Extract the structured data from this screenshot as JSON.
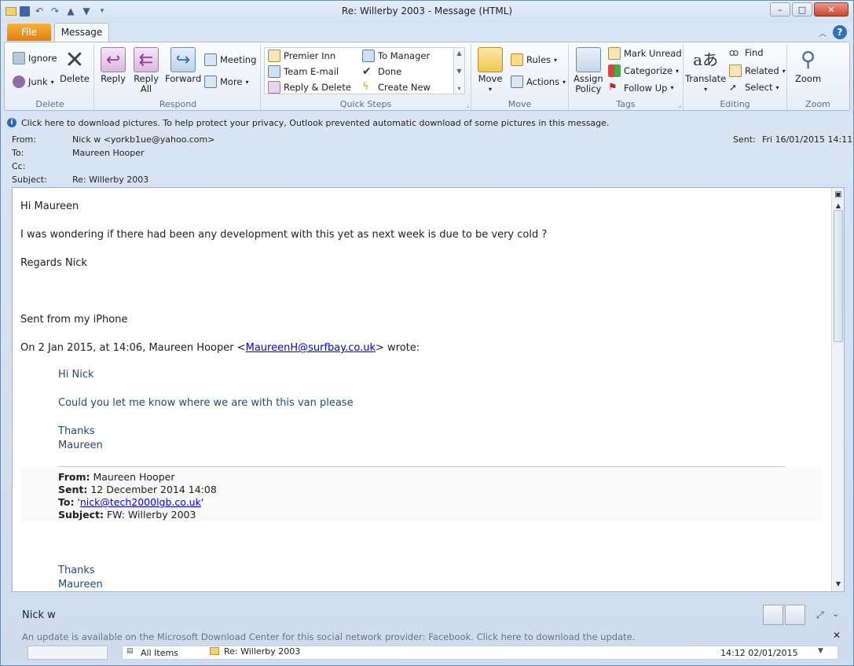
{
  "window": {
    "title": "Re: Willerby 2003  -  Message (HTML)"
  },
  "tabs": {
    "file": "File",
    "message": "Message"
  },
  "ribbon": {
    "delete_group": {
      "label": "Delete",
      "ignore": "Ignore",
      "junk": "Junk",
      "delete": "Delete"
    },
    "respond_group": {
      "label": "Respond",
      "reply": "Reply",
      "reply_all_1": "Reply",
      "reply_all_2": "All",
      "forward": "Forward",
      "meeting": "Meeting",
      "more": "More"
    },
    "quick_steps": {
      "label": "Quick Steps",
      "premier_inn": "Premier Inn",
      "team_email": "Team E-mail",
      "reply_delete": "Reply & Delete",
      "to_manager": "To Manager",
      "done": "Done",
      "create_new": "Create New"
    },
    "move_group": {
      "label": "Move",
      "move": "Move",
      "rules": "Rules",
      "actions": "Actions"
    },
    "tags_group": {
      "label": "Tags",
      "assign_policy_1": "Assign",
      "assign_policy_2": "Policy",
      "mark_unread": "Mark Unread",
      "categorize": "Categorize",
      "follow_up": "Follow Up"
    },
    "editing_group": {
      "label": "Editing",
      "translate": "Translate",
      "find": "Find",
      "related": "Related",
      "select": "Select"
    },
    "zoom_group": {
      "label": "Zoom",
      "zoom": "Zoom"
    }
  },
  "infobar": {
    "text": "Click here to download pictures. To help protect your privacy, Outlook prevented automatic download of some pictures in this message."
  },
  "header": {
    "from_label": "From:",
    "from_value": "Nick w <yorkb1ue@yahoo.com>",
    "to_label": "To:",
    "to_value": "Maureen Hooper",
    "cc_label": "Cc:",
    "subject_label": "Subject:",
    "subject_value": "Re: Willerby 2003",
    "sent_label": "Sent:",
    "sent_value": "Fri 16/01/2015 14:11"
  },
  "body": {
    "greeting": "Hi Maureen",
    "line1": "I was wondering if there had been any development with this yet as next week is due to be very cold ?",
    "regards": "Regards Nick",
    "sent_from": "Sent from my iPhone",
    "quote_intro_pre": "On 2 Jan 2015, at 14:06, Maureen Hooper <",
    "quote_intro_link": "MaureenH@surfbay.co.uk",
    "quote_intro_post": "> wrote:",
    "q_hi": "Hi Nick",
    "q_line": "Could you let me know where we are with this van please",
    "q_thanks": "Thanks",
    "q_name": "Maureen",
    "fwd_from_label": "From:",
    "fwd_from": " Maureen Hooper",
    "fwd_sent_label": "Sent:",
    "fwd_sent": " 12 December 2014 14:08",
    "fwd_to_label": "To:",
    "fwd_to_pre": " '",
    "fwd_to_link": "nick@tech2000lgb.co.uk",
    "fwd_to_post": "'",
    "fwd_subject_label": "Subject:",
    "fwd_subject": " FW: Willerby 2003",
    "q2_thanks": "Thanks",
    "q2_name": "Maureen"
  },
  "people_pane": {
    "name": "Nick w",
    "update_text": "An update is available on the Microsoft Download Center for this social network provider: Facebook. Click here to download the update.",
    "all_items": "All Items",
    "item_subject": "Re: Willerby 2003",
    "item_time": "14:12 02/01/2015"
  },
  "colors": {
    "file_tab": "#e07d0c",
    "quote_blue": "#1f497d",
    "link": "#0000ee",
    "info_icon": "#2e67b8"
  }
}
